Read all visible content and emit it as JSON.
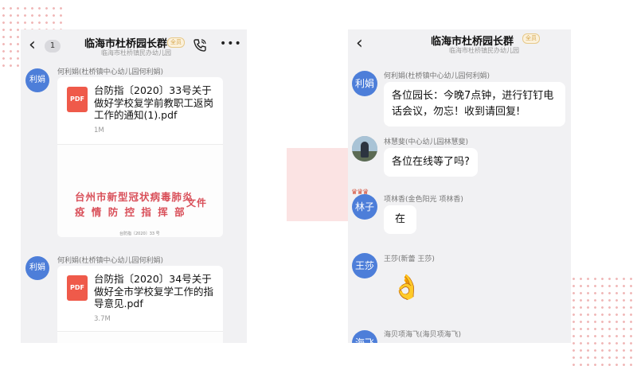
{
  "left_screen": {
    "back_count": "1",
    "title": "临海市杜桥园长群",
    "title_tag": "全员",
    "subtitle": "临海市杜桥镇民办幼儿园",
    "messages": [
      {
        "avatar_text": "利娟",
        "sender": "何利娟(杜桥镇中心幼儿园何利娟)",
        "file_icon_label": "PDF",
        "file_name": "台防指〔2020〕33号关于做好学校复学前教职工返岗工作的通知(1).pdf",
        "file_size": "1M",
        "preview_line1": "台州市新型冠状病毒肺炎",
        "preview_line2": "疫 情 防 控 指 挥 部",
        "preview_suffix": "文件",
        "preview_number": "台防指〔2020〕33 号"
      },
      {
        "avatar_text": "利娟",
        "sender": "何利娟(杜桥镇中心幼儿园何利娟)",
        "file_icon_label": "PDF",
        "file_name": "台防指〔2020〕34号关于做好全市学校复学工作的指导意见.pdf",
        "file_size": "3.7M"
      }
    ]
  },
  "right_screen": {
    "title": "临海市杜桥园长群",
    "title_tag": "全员",
    "subtitle": "临海市杜桥镇民办幼儿园",
    "messages": [
      {
        "avatar_text": "利娟",
        "sender": "何利娟(杜桥镇中心幼儿园何利娟)",
        "text": "各位园长：今晚7点钟，进行钉钉电话会议，勿忘！收到请回复!"
      },
      {
        "avatar_text": "",
        "sender": "林慧斐(中心幼儿园林慧斐)",
        "text": "各位在线等了吗?"
      },
      {
        "avatar_text": "林子",
        "sender": "项林香(金色阳光 项林香)",
        "text": "在"
      },
      {
        "avatar_text": "王莎",
        "sender": "王莎(新蕾 王莎)",
        "emoji": "👌"
      },
      {
        "avatar_text": "海飞",
        "sender": "海贝项海飞(海贝项海飞)"
      }
    ]
  },
  "icons": {
    "back": "back-arrow-icon",
    "call": "phone-call-icon",
    "more": "more-icon",
    "file": "pdf-file-icon"
  },
  "colors": {
    "avatar_blue": "#4d7ed9",
    "pdf_red": "#ef5a4a",
    "doc_red": "#d9505a",
    "chat_bg": "#f1f1f3"
  }
}
